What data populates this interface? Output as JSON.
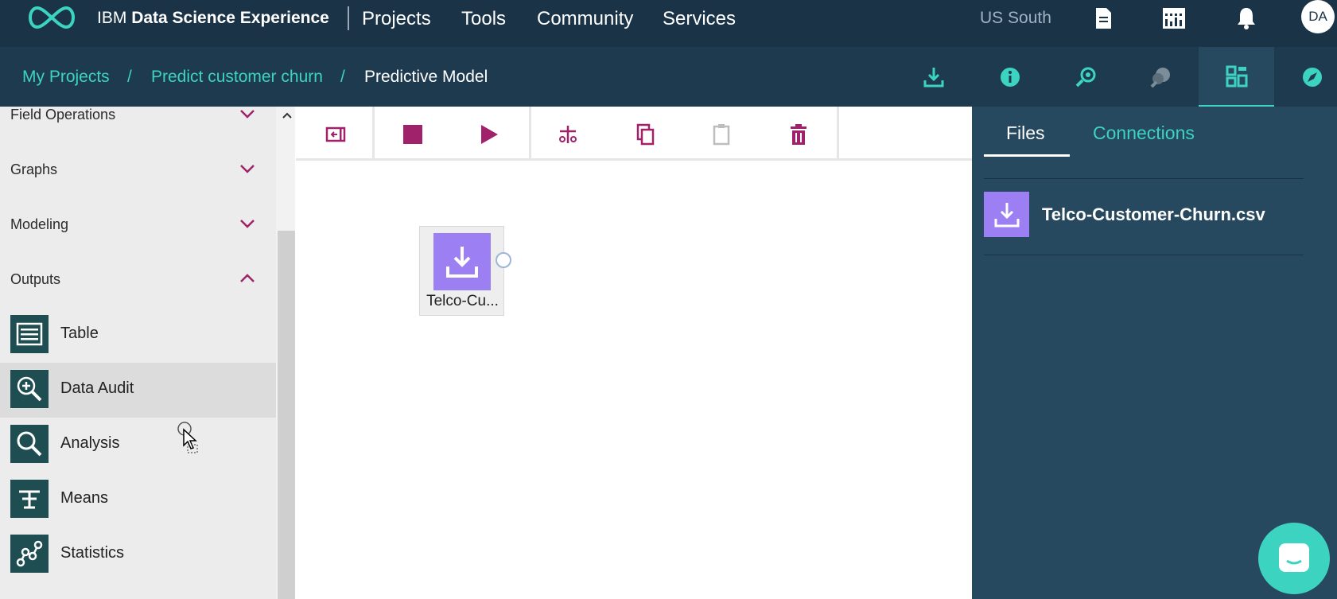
{
  "topnav": {
    "brand_prefix": "IBM",
    "brand_name": "Data Science Experience",
    "links": [
      "Projects",
      "Tools",
      "Community",
      "Services"
    ],
    "region": "US South",
    "avatar_initials": "DA",
    "accent_color": "#3dd3c1",
    "bg_color": "#1a3347"
  },
  "breadcrumb": {
    "items": [
      "My Projects",
      "Predict customer churn",
      "Predictive Model"
    ],
    "separator": "/"
  },
  "right_tabs": {
    "icons": [
      "info-icon",
      "data-refine-icon",
      "palette-icon",
      "find-data-icon",
      "compass-icon"
    ],
    "active_index": 3
  },
  "palette": {
    "categories": [
      {
        "label": "Field Operations",
        "expanded": false
      },
      {
        "label": "Graphs",
        "expanded": false
      },
      {
        "label": "Modeling",
        "expanded": false
      },
      {
        "label": "Outputs",
        "expanded": true
      }
    ],
    "nodes": [
      {
        "label": "Table",
        "icon": "table-icon"
      },
      {
        "label": "Data Audit",
        "icon": "data-audit-icon"
      },
      {
        "label": "Analysis",
        "icon": "analysis-icon"
      },
      {
        "label": "Means",
        "icon": "means-icon"
      },
      {
        "label": "Statistics",
        "icon": "statistics-icon"
      }
    ],
    "hovered_node": "Data Audit",
    "accent_color": "#a0226b"
  },
  "toolbar": {
    "buttons": [
      "toggle-palette-icon",
      "stop-icon",
      "run-icon",
      "cut-icon",
      "copy-icon",
      "paste-icon",
      "delete-icon"
    ]
  },
  "canvas": {
    "nodes": [
      {
        "label": "Telco-Cu...",
        "icon": "data-asset-icon",
        "color": "#9c7ff3"
      }
    ]
  },
  "right_panel": {
    "tabs": [
      "Files",
      "Connections"
    ],
    "active_tab": "Files",
    "files": [
      {
        "name": "Telco-Customer-Churn.csv",
        "icon": "download-icon"
      }
    ]
  }
}
